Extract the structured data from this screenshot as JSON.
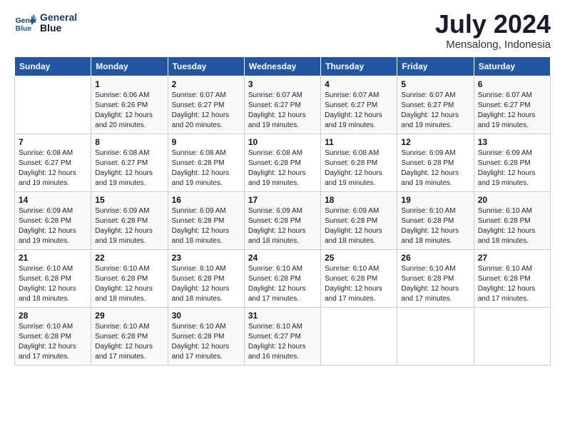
{
  "logo": {
    "line1": "General",
    "line2": "Blue"
  },
  "title": "July 2024",
  "location": "Mensalong, Indonesia",
  "days_header": [
    "Sunday",
    "Monday",
    "Tuesday",
    "Wednesday",
    "Thursday",
    "Friday",
    "Saturday"
  ],
  "weeks": [
    [
      {
        "day": "",
        "info": ""
      },
      {
        "day": "1",
        "info": "Sunrise: 6:06 AM\nSunset: 6:26 PM\nDaylight: 12 hours\nand 20 minutes."
      },
      {
        "day": "2",
        "info": "Sunrise: 6:07 AM\nSunset: 6:27 PM\nDaylight: 12 hours\nand 20 minutes."
      },
      {
        "day": "3",
        "info": "Sunrise: 6:07 AM\nSunset: 6:27 PM\nDaylight: 12 hours\nand 19 minutes."
      },
      {
        "day": "4",
        "info": "Sunrise: 6:07 AM\nSunset: 6:27 PM\nDaylight: 12 hours\nand 19 minutes."
      },
      {
        "day": "5",
        "info": "Sunrise: 6:07 AM\nSunset: 6:27 PM\nDaylight: 12 hours\nand 19 minutes."
      },
      {
        "day": "6",
        "info": "Sunrise: 6:07 AM\nSunset: 6:27 PM\nDaylight: 12 hours\nand 19 minutes."
      }
    ],
    [
      {
        "day": "7",
        "info": "Sunrise: 6:08 AM\nSunset: 6:27 PM\nDaylight: 12 hours\nand 19 minutes."
      },
      {
        "day": "8",
        "info": "Sunrise: 6:08 AM\nSunset: 6:27 PM\nDaylight: 12 hours\nand 19 minutes."
      },
      {
        "day": "9",
        "info": "Sunrise: 6:08 AM\nSunset: 6:28 PM\nDaylight: 12 hours\nand 19 minutes."
      },
      {
        "day": "10",
        "info": "Sunrise: 6:08 AM\nSunset: 6:28 PM\nDaylight: 12 hours\nand 19 minutes."
      },
      {
        "day": "11",
        "info": "Sunrise: 6:08 AM\nSunset: 6:28 PM\nDaylight: 12 hours\nand 19 minutes."
      },
      {
        "day": "12",
        "info": "Sunrise: 6:09 AM\nSunset: 6:28 PM\nDaylight: 12 hours\nand 19 minutes."
      },
      {
        "day": "13",
        "info": "Sunrise: 6:09 AM\nSunset: 6:28 PM\nDaylight: 12 hours\nand 19 minutes."
      }
    ],
    [
      {
        "day": "14",
        "info": "Sunrise: 6:09 AM\nSunset: 6:28 PM\nDaylight: 12 hours\nand 19 minutes."
      },
      {
        "day": "15",
        "info": "Sunrise: 6:09 AM\nSunset: 6:28 PM\nDaylight: 12 hours\nand 19 minutes."
      },
      {
        "day": "16",
        "info": "Sunrise: 6:09 AM\nSunset: 6:28 PM\nDaylight: 12 hours\nand 18 minutes."
      },
      {
        "day": "17",
        "info": "Sunrise: 6:09 AM\nSunset: 6:28 PM\nDaylight: 12 hours\nand 18 minutes."
      },
      {
        "day": "18",
        "info": "Sunrise: 6:09 AM\nSunset: 6:28 PM\nDaylight: 12 hours\nand 18 minutes."
      },
      {
        "day": "19",
        "info": "Sunrise: 6:10 AM\nSunset: 6:28 PM\nDaylight: 12 hours\nand 18 minutes."
      },
      {
        "day": "20",
        "info": "Sunrise: 6:10 AM\nSunset: 6:28 PM\nDaylight: 12 hours\nand 18 minutes."
      }
    ],
    [
      {
        "day": "21",
        "info": "Sunrise: 6:10 AM\nSunset: 6:28 PM\nDaylight: 12 hours\nand 18 minutes."
      },
      {
        "day": "22",
        "info": "Sunrise: 6:10 AM\nSunset: 6:28 PM\nDaylight: 12 hours\nand 18 minutes."
      },
      {
        "day": "23",
        "info": "Sunrise: 6:10 AM\nSunset: 6:28 PM\nDaylight: 12 hours\nand 18 minutes."
      },
      {
        "day": "24",
        "info": "Sunrise: 6:10 AM\nSunset: 6:28 PM\nDaylight: 12 hours\nand 17 minutes."
      },
      {
        "day": "25",
        "info": "Sunrise: 6:10 AM\nSunset: 6:28 PM\nDaylight: 12 hours\nand 17 minutes."
      },
      {
        "day": "26",
        "info": "Sunrise: 6:10 AM\nSunset: 6:28 PM\nDaylight: 12 hours\nand 17 minutes."
      },
      {
        "day": "27",
        "info": "Sunrise: 6:10 AM\nSunset: 6:28 PM\nDaylight: 12 hours\nand 17 minutes."
      }
    ],
    [
      {
        "day": "28",
        "info": "Sunrise: 6:10 AM\nSunset: 6:28 PM\nDaylight: 12 hours\nand 17 minutes."
      },
      {
        "day": "29",
        "info": "Sunrise: 6:10 AM\nSunset: 6:28 PM\nDaylight: 12 hours\nand 17 minutes."
      },
      {
        "day": "30",
        "info": "Sunrise: 6:10 AM\nSunset: 6:28 PM\nDaylight: 12 hours\nand 17 minutes."
      },
      {
        "day": "31",
        "info": "Sunrise: 6:10 AM\nSunset: 6:27 PM\nDaylight: 12 hours\nand 16 minutes."
      },
      {
        "day": "",
        "info": ""
      },
      {
        "day": "",
        "info": ""
      },
      {
        "day": "",
        "info": ""
      }
    ]
  ]
}
